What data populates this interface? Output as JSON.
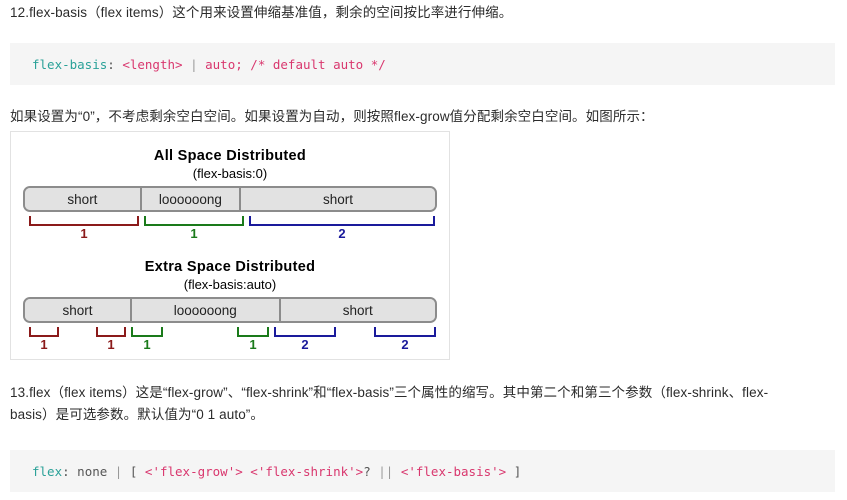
{
  "paragraphs": {
    "item12": "12.flex-basis（flex items）这个用来设置伸缩基准值，剩余的空间按比率进行伸缩。",
    "middle": "如果设置为“0”，不考虑剩余空白空间。如果设置为自动，则按照flex-grow值分配剩余空白空间。如图所示：",
    "item13": "13.flex（flex items）这是“flex-grow”、“flex-shrink”和“flex-basis”三个属性的缩写。其中第二个和第三个参数（flex-shrink、flex-basis）是可选参数。默认值为“0 1 auto”。"
  },
  "code_blocks": {
    "first": {
      "property": "flex-basis",
      "colon": ": ",
      "value_length": "<length>",
      "pipe": " | ",
      "value_auto": "auto;",
      "space": " ",
      "comment": "/* default auto */"
    },
    "second": {
      "property": "flex",
      "colon": ": ",
      "value_none": "none",
      "pipe": " | ",
      "bracket_open": "[ ",
      "grow": "<'flex-grow'>",
      "sp1": " ",
      "shrink": "<'flex-shrink'>",
      "optional": "?",
      "or": " || ",
      "basis": "<'flex-basis'>",
      "bracket_close": " ]"
    }
  },
  "colors": {
    "code_background": "#f5f5f5",
    "token_property": "#2aa198",
    "token_value": "#d9376e",
    "token_plain": "#555555",
    "bracket_red": "#8b1a1a",
    "bracket_green": "#1a7a1a",
    "bracket_blue": "#1a1a9b",
    "box_fill": "#e2e2e2",
    "box_border": "#8c8c8c"
  },
  "figure": {
    "diagrams": [
      {
        "title": "All Space Distributed",
        "subtitle": "(flex-basis:0)",
        "items": [
          {
            "label": "short"
          },
          {
            "label": "loooooong"
          },
          {
            "label": "short"
          }
        ],
        "brackets": [
          {
            "label": "1",
            "color": "red"
          },
          {
            "label": "1",
            "color": "green"
          },
          {
            "label": "2",
            "color": "blue"
          }
        ]
      },
      {
        "title": "Extra Space Distributed",
        "subtitle": "(flex-basis:auto)",
        "items": [
          {
            "label": "short"
          },
          {
            "label": "loooooong"
          },
          {
            "label": "short"
          }
        ],
        "brackets": [
          {
            "label": "1",
            "color": "red"
          },
          {
            "label": "1",
            "color": "red"
          },
          {
            "label": "1",
            "color": "green"
          },
          {
            "label": "1",
            "color": "green"
          },
          {
            "label": "2",
            "color": "blue"
          },
          {
            "label": "2",
            "color": "blue"
          }
        ]
      }
    ]
  }
}
